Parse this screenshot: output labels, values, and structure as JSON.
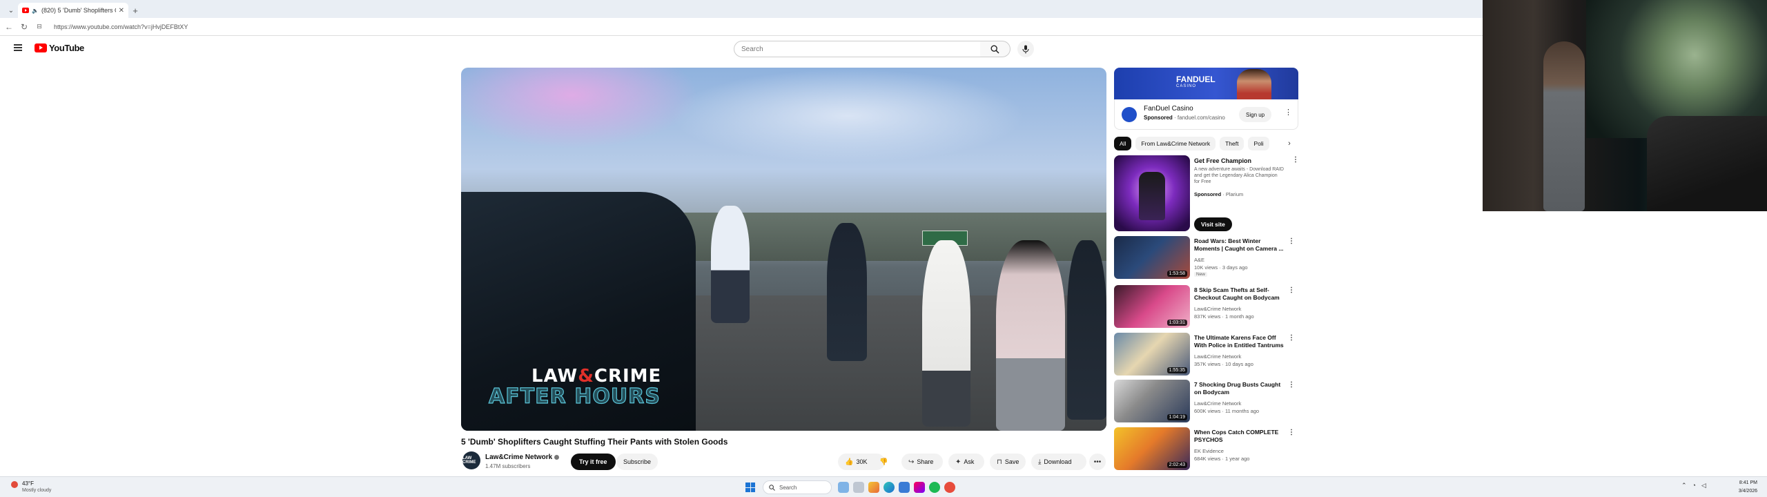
{
  "browser": {
    "tab_title": "(820) 5 'Dumb' Shoplifters Ca...",
    "url": "https://www.youtube.com/watch?v=jHvjDEFBtXY"
  },
  "header": {
    "logo_text": "YouTube",
    "search_placeholder": "Search"
  },
  "player": {
    "watermark_line1_a": "LAW",
    "watermark_line1_sep": "&",
    "watermark_line1_b": "CRIME",
    "watermark_line2": "AFTER HOURS"
  },
  "video": {
    "title": "5 'Dumb' Shoplifters Caught Stuffing Their Pants with Stolen Goods",
    "channel": "Law&Crime Network",
    "subscribers": "1.47M subscribers",
    "avatar_text": "LAW CRIME",
    "try_label": "Try it free",
    "subscribe_label": "Subscribe",
    "likes": "30K",
    "share_label": "Share",
    "ask_label": "Ask",
    "save_label": "Save",
    "download_label": "Download"
  },
  "ad": {
    "brand": "FANDUEL",
    "brand_sub": "CASINO",
    "name": "FanDuel Casino",
    "sponsored": "Sponsored",
    "domain": "fanduel.com/casino",
    "signup_label": "Sign up"
  },
  "chips": [
    "All",
    "From Law&Crime Network",
    "Theft",
    "Poli"
  ],
  "rec_ad": {
    "title": "Get Free Champion",
    "description": "A new adventure awaits - Download RAID and get the Legendary Alica Champion for Free",
    "sponsored": "Sponsored",
    "advertiser": "Plarium",
    "visit_label": "Visit site"
  },
  "recommendations": [
    {
      "title": "Road Wars: Best Winter Moments | Caught on Camera ...",
      "channel": "A&E",
      "meta": "10K views · 3 days ago",
      "badge": "New",
      "duration": "1:53:58"
    },
    {
      "title": "8 Skip Scam Thefts at Self-Checkout Caught on Bodycam",
      "channel": "Law&Crime Network",
      "meta": "837K views · 1 month ago",
      "badge": "",
      "duration": "1:03:31"
    },
    {
      "title": "The Ultimate Karens Face Off With Police in Entitled Tantrums",
      "channel": "Law&Crime Network",
      "meta": "357K views · 10 days ago",
      "badge": "",
      "duration": "1:55:35"
    },
    {
      "title": "7 Shocking Drug Busts Caught on Bodycam",
      "channel": "Law&Crime Network",
      "meta": "600K views · 11 months ago",
      "badge": "",
      "duration": "1:04:19"
    },
    {
      "title": "When Cops Catch COMPLETE PSYCHOS",
      "channel": "EK Evidence",
      "meta": "684K views · 1 year ago",
      "badge": "",
      "duration": "2:02:43"
    }
  ],
  "taskbar": {
    "temp": "43°F",
    "weather": "Mostly cloudy",
    "search_label": "Search",
    "time": "8:41 PM",
    "date": "3/4/2026"
  }
}
